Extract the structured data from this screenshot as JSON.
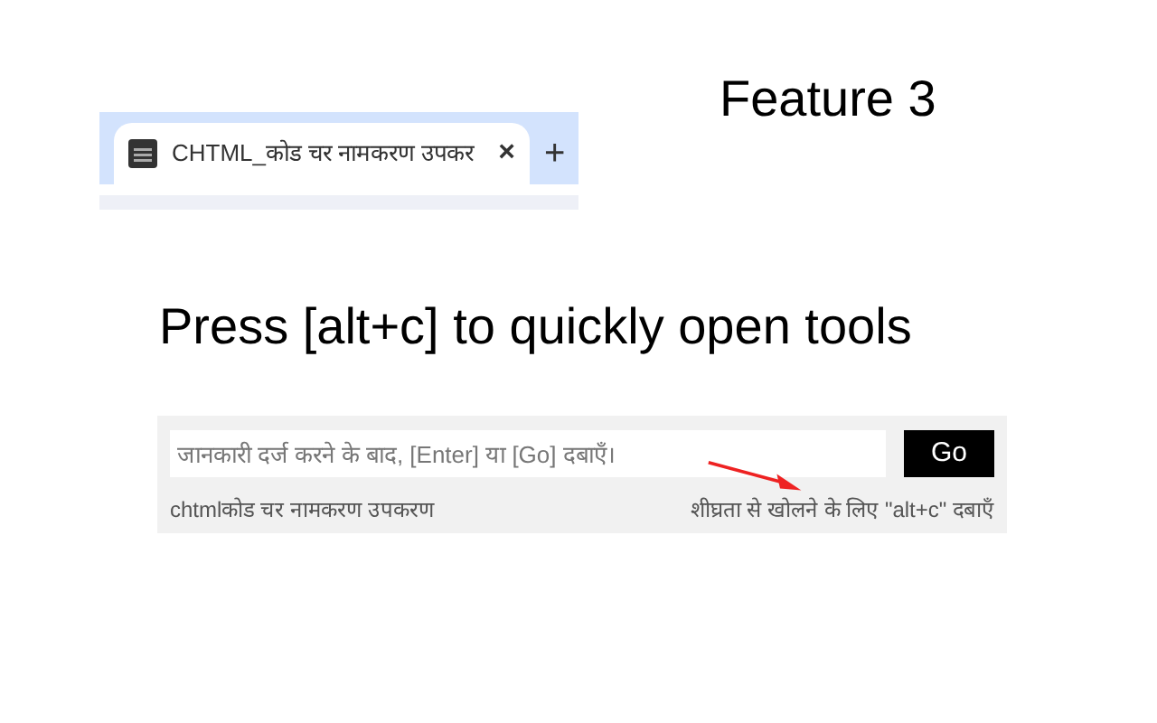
{
  "heading": "Feature 3",
  "browser_tab": {
    "title": "CHTML_कोड चर नामकरण उपकर",
    "close": "×",
    "new_tab": "+"
  },
  "caption": "Press [alt+c] to quickly open tools",
  "popup": {
    "placeholder": "जानकारी दर्ज करने के बाद, [Enter] या [Go] दबाएँ।",
    "button": "Go",
    "footer_left": "chtmlकोड चर नामकरण उपकरण",
    "footer_right": "शीघ्रता से खोलने के लिए \"alt+c\" दबाएँ"
  }
}
